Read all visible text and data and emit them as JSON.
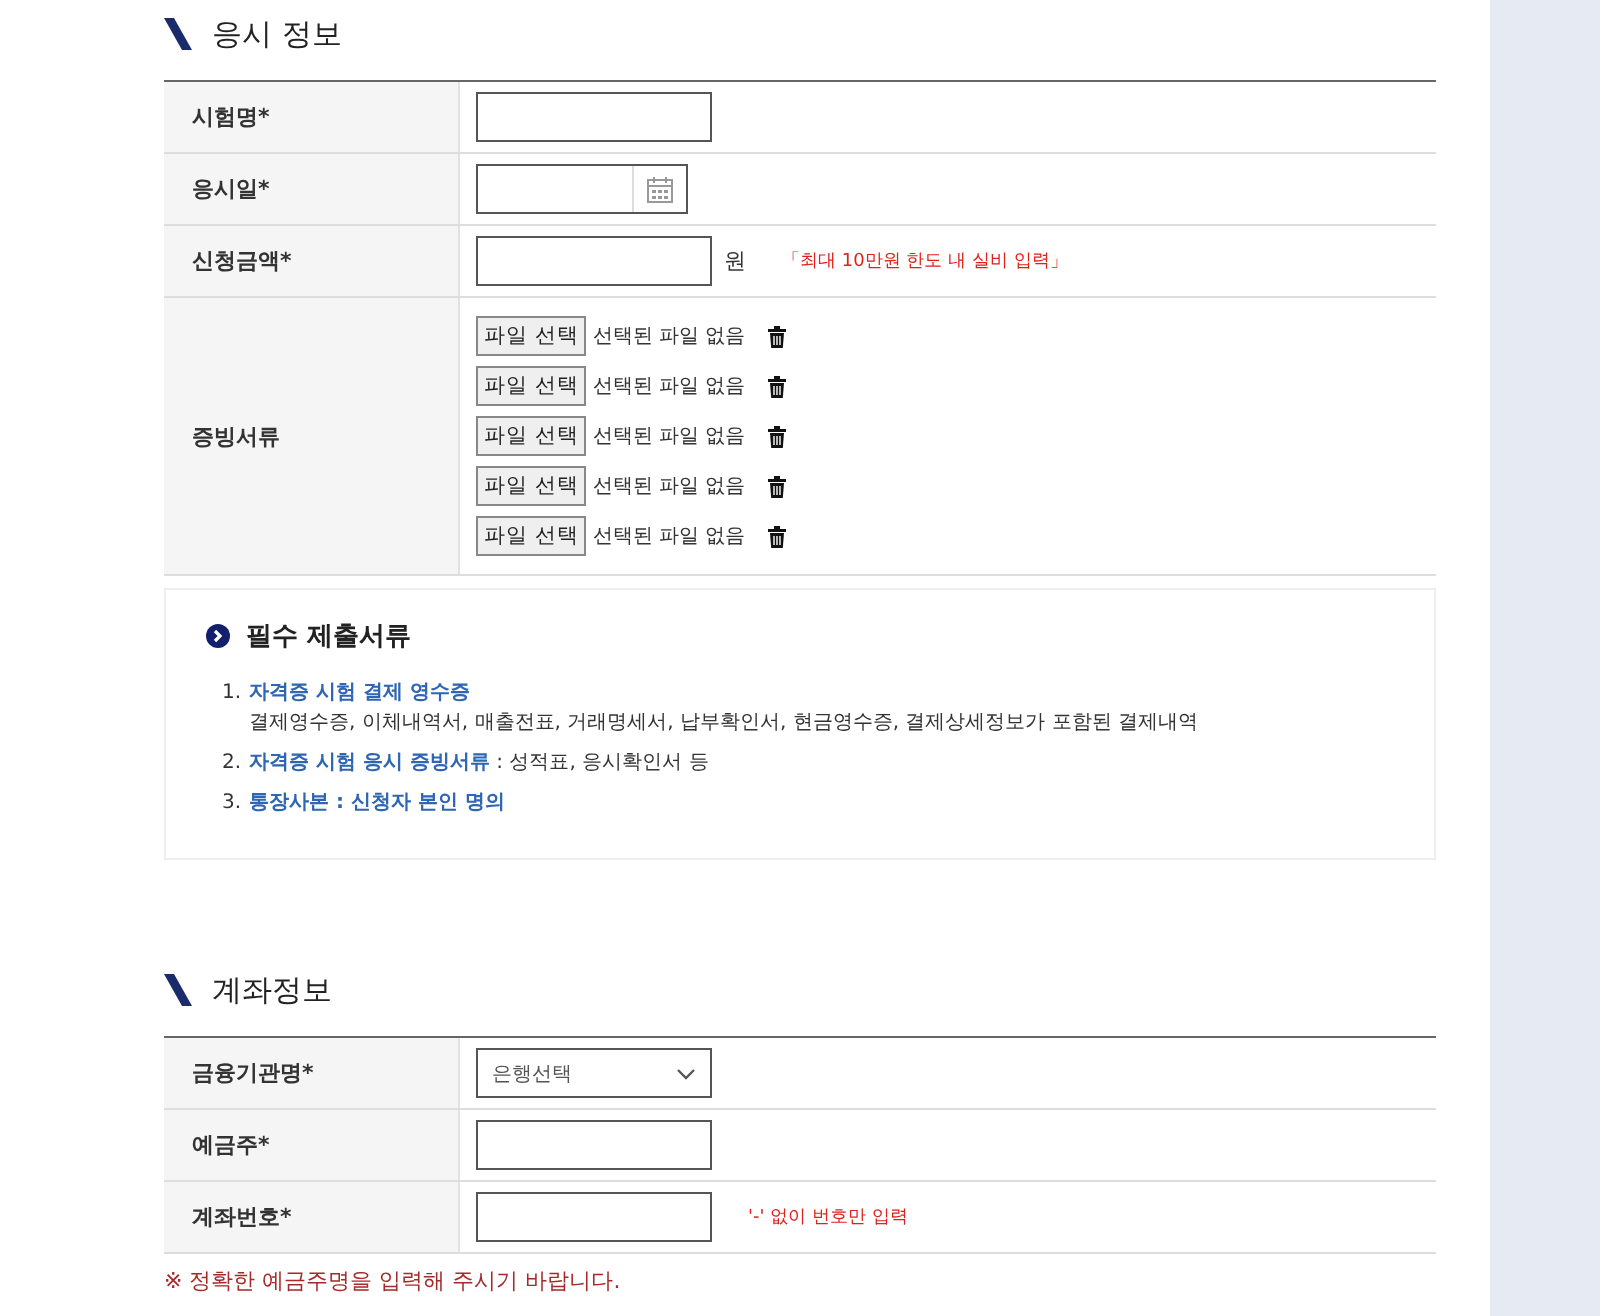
{
  "sections": [
    {
      "title": "응시 정보",
      "rows": [
        {
          "label": "시험명*",
          "kind": "text"
        },
        {
          "label": "응시일*",
          "kind": "date"
        },
        {
          "label": "신청금액*",
          "kind": "text",
          "unit": "원",
          "note": "「최대 10만원 한도 내 실비 입력」"
        },
        {
          "label": "증빙서류",
          "kind": "files",
          "files": [
            {
              "button": "파일 선택",
              "status": "선택된 파일 없음"
            },
            {
              "button": "파일 선택",
              "status": "선택된 파일 없음"
            },
            {
              "button": "파일 선택",
              "status": "선택된 파일 없음"
            },
            {
              "button": "파일 선택",
              "status": "선택된 파일 없음"
            },
            {
              "button": "파일 선택",
              "status": "선택된 파일 없음"
            }
          ]
        }
      ],
      "notice": {
        "title": "필수 제출서류",
        "items": [
          {
            "number": "1.",
            "link": "자격증 시험 결제 영수증",
            "detail": "결제영수증, 이체내역서, 매출전표, 거래명세서, 납부확인서, 현금영수증, 결제상세정보가 포함된 결제내역"
          },
          {
            "number": "2.",
            "link": "자격증 시험 응시 증빙서류",
            "rest": " : 성적표, 응시확인서 등"
          },
          {
            "number": "3.",
            "link": "통장사본 : 신청자 본인 명의"
          }
        ]
      }
    },
    {
      "title": "계좌정보",
      "rows": [
        {
          "label": "금융기관명*",
          "kind": "select",
          "value": "은행선택"
        },
        {
          "label": "예금주*",
          "kind": "text"
        },
        {
          "label": "계좌번호*",
          "kind": "text",
          "note": "'-' 없이 번호만 입력"
        }
      ],
      "footnote": "※ 정확한 예금주명을 입력해 주시기 바랍니다."
    }
  ]
}
